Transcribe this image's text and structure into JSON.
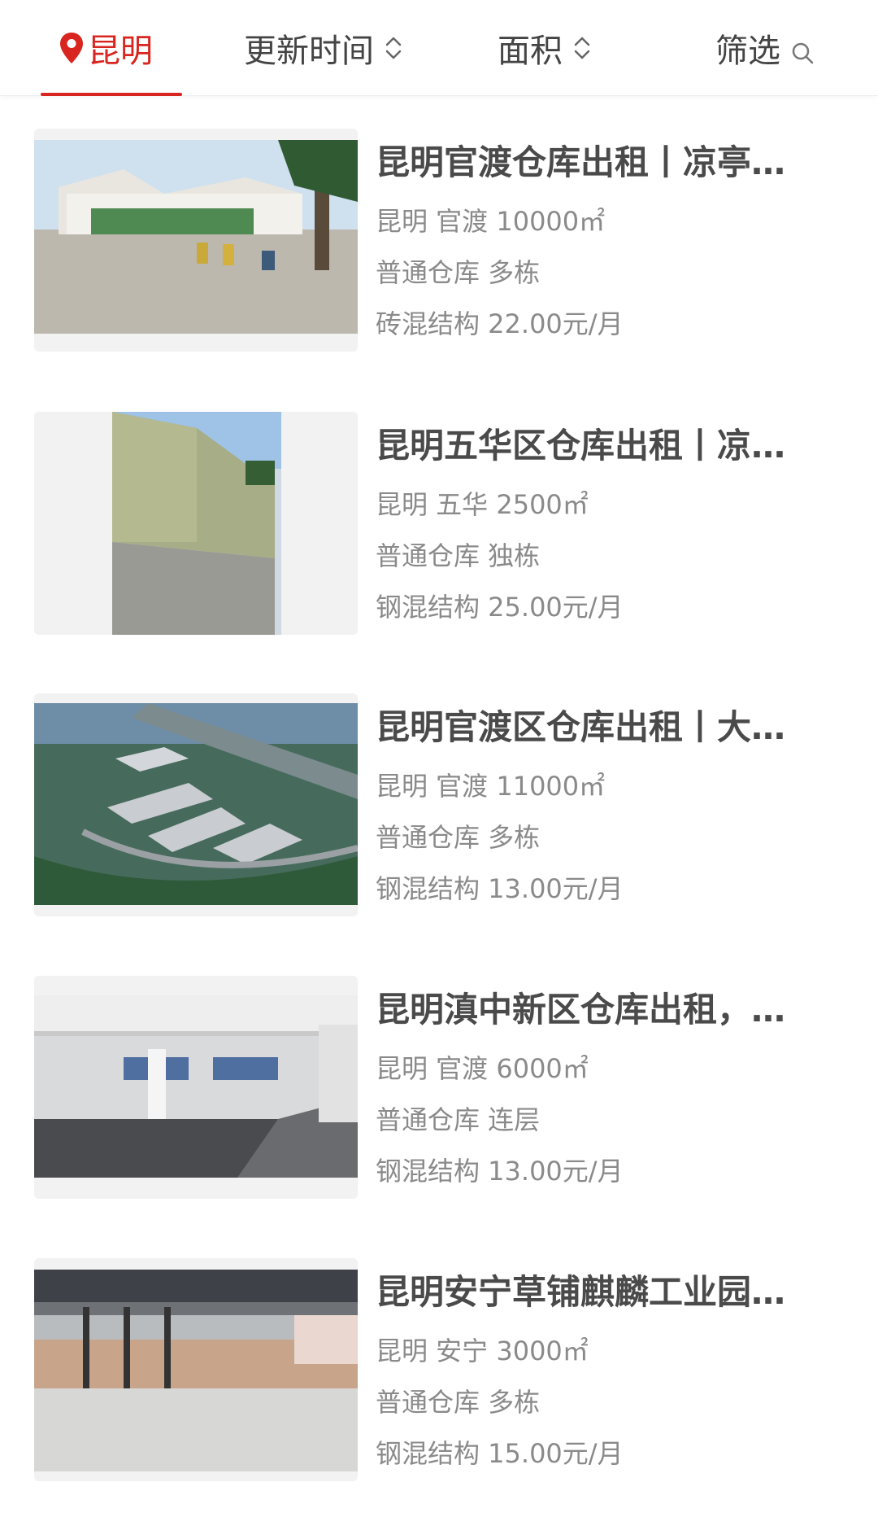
{
  "filter_bar": {
    "city": "昆明",
    "sort_time": "更新时间",
    "sort_area": "面积",
    "filter": "筛选",
    "icons": {
      "city": "location-pin-icon",
      "sort": "sort-up-down-icon",
      "filter": "search-icon"
    },
    "accent_color": "#d9251f"
  },
  "listings": [
    {
      "title": "昆明官渡仓库出租丨凉亭…",
      "location_area": "昆明 官渡 10000㎡",
      "type": "普通仓库 多栋",
      "structure_price": "砖混结构 22.00元/月"
    },
    {
      "title": "昆明五华区仓库出租丨凉…",
      "location_area": "昆明 五华 2500㎡",
      "type": "普通仓库 独栋",
      "structure_price": "钢混结构 25.00元/月"
    },
    {
      "title": "昆明官渡区仓库出租丨大…",
      "location_area": "昆明 官渡 11000㎡",
      "type": "普通仓库 多栋",
      "structure_price": "钢混结构 13.00元/月"
    },
    {
      "title": "昆明滇中新区仓库出租，…",
      "location_area": "昆明 官渡 6000㎡",
      "type": "普通仓库 连层",
      "structure_price": "钢混结构 13.00元/月"
    },
    {
      "title": "昆明安宁草铺麒麟工业园…",
      "location_area": "昆明 安宁 3000㎡",
      "type": "普通仓库 多栋",
      "structure_price": "钢混结构 15.00元/月"
    }
  ]
}
